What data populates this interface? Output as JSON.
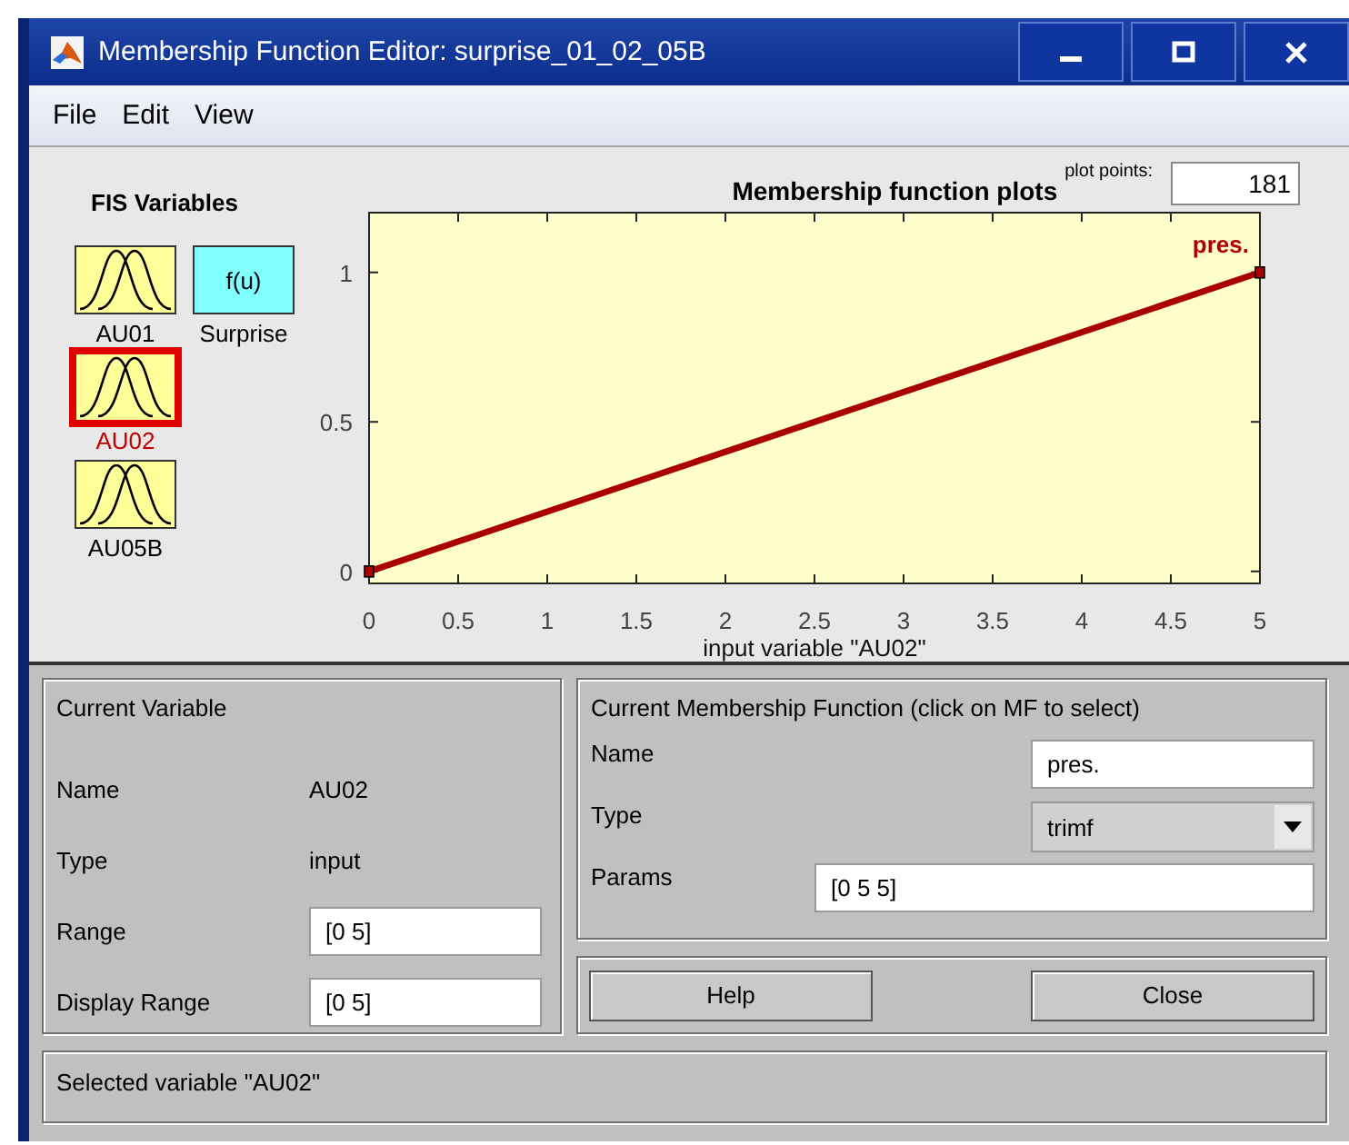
{
  "window": {
    "title": "Membership Function Editor: surprise_01_02_05B"
  },
  "menu": [
    "File",
    "Edit",
    "View"
  ],
  "fis_variables": {
    "title": "FIS Variables",
    "items": [
      {
        "name": "AU01",
        "kind": "input",
        "selected": false
      },
      {
        "name": "Surprise",
        "kind": "output",
        "symbol": "f(u)",
        "selected": false
      },
      {
        "name": "AU02",
        "kind": "input",
        "selected": true
      },
      {
        "name": "AU05B",
        "kind": "input",
        "selected": false
      }
    ]
  },
  "plot": {
    "plot_points_label": "plot points:",
    "plot_points": "181",
    "chart_data": {
      "type": "line",
      "title": "Membership function plots",
      "xlabel": "input variable \"AU02\"",
      "x": [
        0,
        5
      ],
      "series": [
        {
          "name": "pres.",
          "color": "#aa0000",
          "marker": "square",
          "values": [
            0,
            1
          ]
        }
      ],
      "xlim": [
        0,
        5
      ],
      "ylim": [
        -0.04,
        1.2
      ],
      "xticks": [
        0,
        0.5,
        1,
        1.5,
        2,
        2.5,
        3,
        3.5,
        4,
        4.5,
        5
      ],
      "yticks": [
        0,
        0.5,
        1
      ]
    }
  },
  "current_variable": {
    "title": "Current Variable",
    "fields": [
      {
        "label": "Name",
        "value": "AU02",
        "kind": "text"
      },
      {
        "label": "Type",
        "value": "input",
        "kind": "text"
      },
      {
        "label": "Range",
        "value": "[0 5]",
        "kind": "input"
      },
      {
        "label": "Display Range",
        "value": "[0 5]",
        "kind": "input"
      }
    ]
  },
  "current_mf": {
    "title": "Current Membership Function (click on MF to select)",
    "name": {
      "label": "Name",
      "value": "pres."
    },
    "type": {
      "label": "Type",
      "value": "trimf"
    },
    "params": {
      "label": "Params",
      "value": "[0 5 5]"
    }
  },
  "buttons": [
    "Help",
    "Close"
  ],
  "status": "Selected variable \"AU02\""
}
